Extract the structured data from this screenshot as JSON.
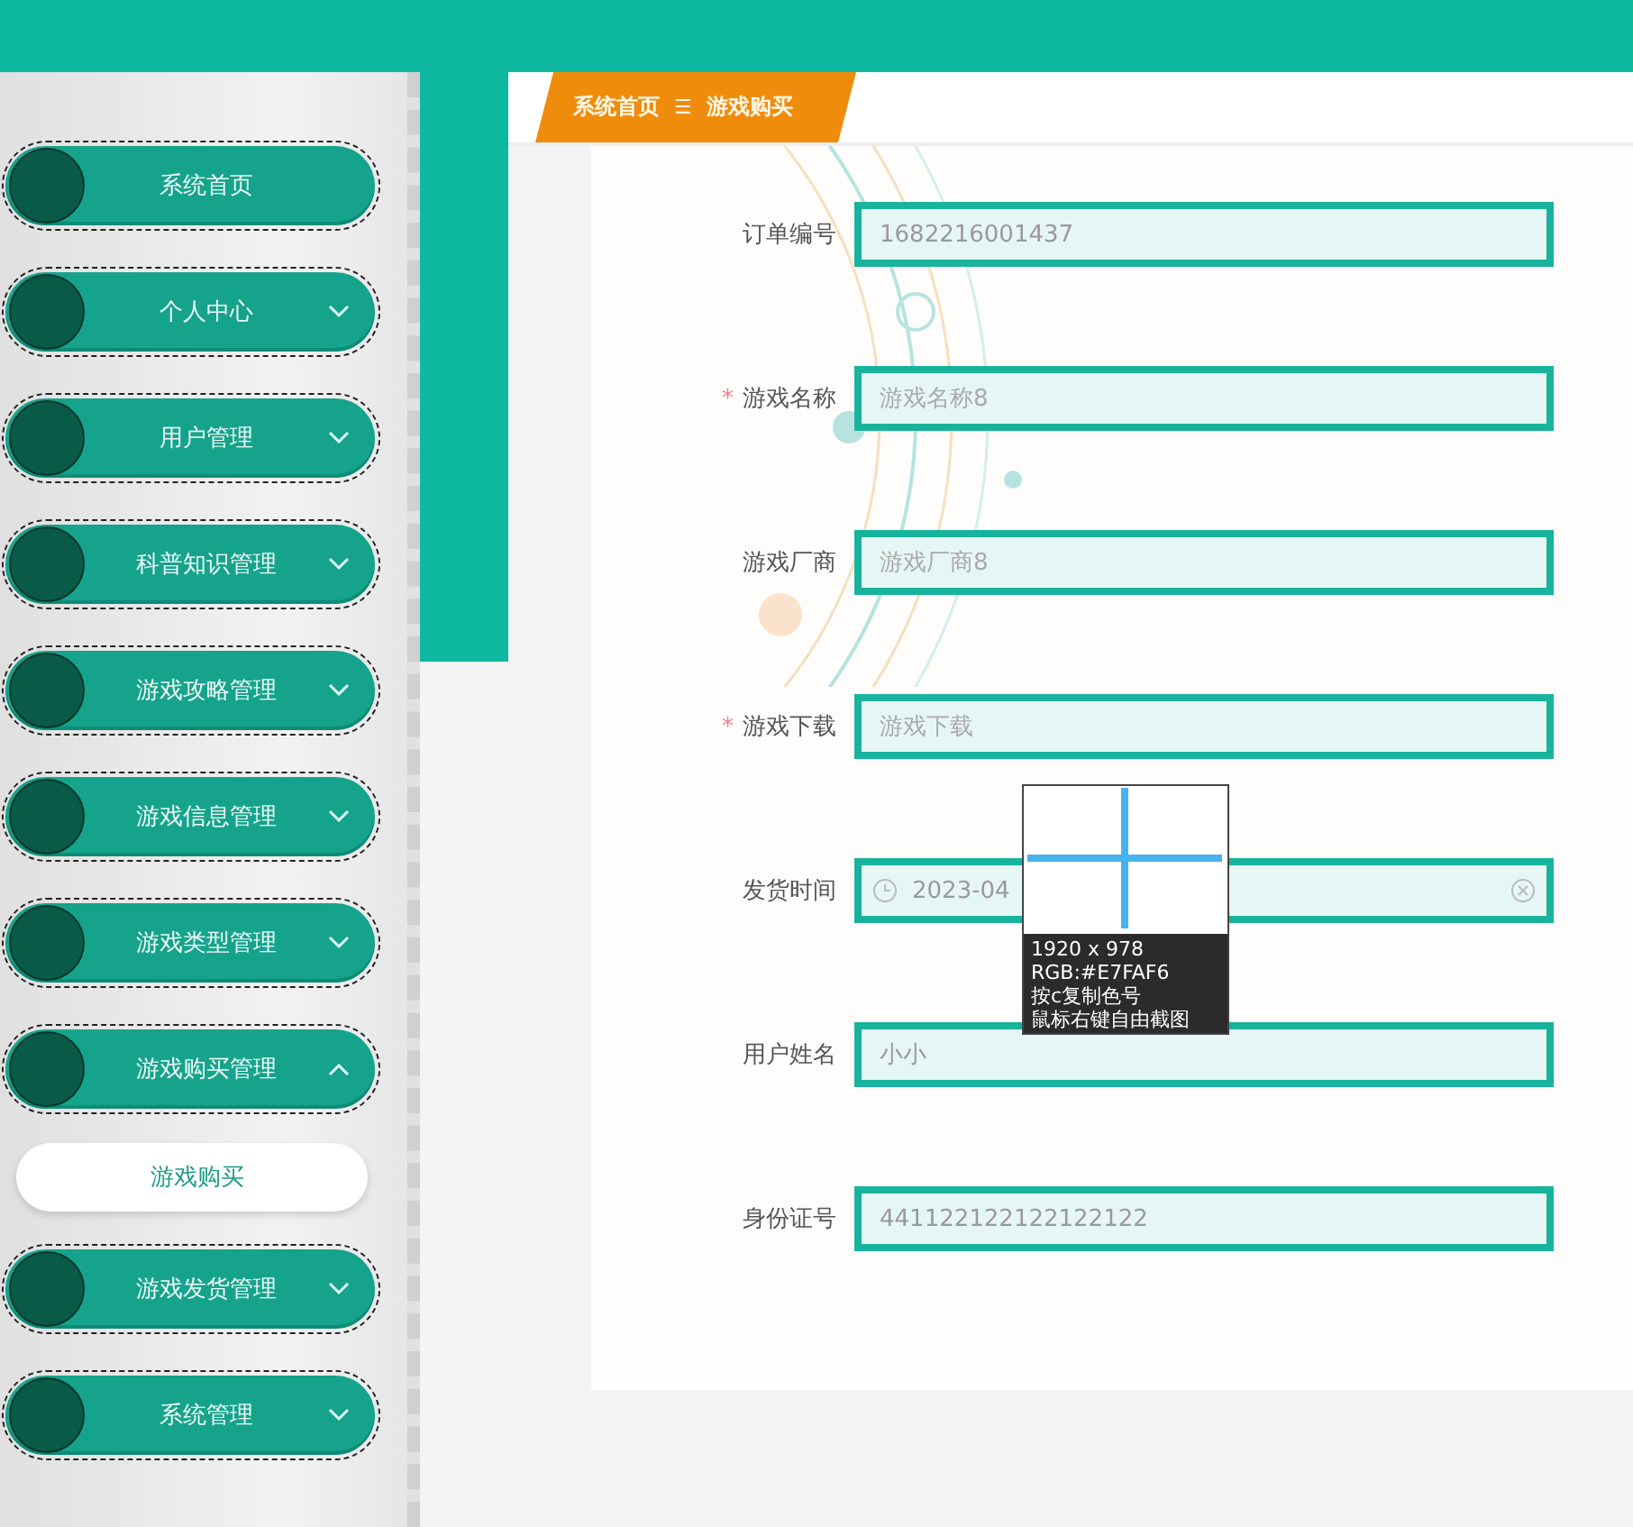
{
  "sidebar": {
    "items": [
      {
        "label": "系统首页",
        "expandable": false
      },
      {
        "label": "个人中心",
        "expandable": true,
        "expanded": false
      },
      {
        "label": "用户管理",
        "expandable": true,
        "expanded": false
      },
      {
        "label": "科普知识管理",
        "expandable": true,
        "expanded": false
      },
      {
        "label": "游戏攻略管理",
        "expandable": true,
        "expanded": false
      },
      {
        "label": "游戏信息管理",
        "expandable": true,
        "expanded": false
      },
      {
        "label": "游戏类型管理",
        "expandable": true,
        "expanded": false
      },
      {
        "label": "游戏购买管理",
        "expandable": true,
        "expanded": true,
        "children": [
          {
            "label": "游戏购买",
            "selected": true
          }
        ]
      },
      {
        "label": "游戏发货管理",
        "expandable": true,
        "expanded": false
      },
      {
        "label": "系统管理",
        "expandable": true,
        "expanded": false
      }
    ]
  },
  "breadcrumb": {
    "items": [
      "系统首页",
      "游戏购买"
    ],
    "separator": "☰"
  },
  "form": {
    "required_mark": "*",
    "fields": [
      {
        "label": "订单编号",
        "required": false,
        "kind": "text",
        "value": "1682216001437"
      },
      {
        "label": "游戏名称",
        "required": true,
        "kind": "text",
        "placeholder": "游戏名称8"
      },
      {
        "label": "游戏厂商",
        "required": false,
        "kind": "text",
        "placeholder": "游戏厂商8"
      },
      {
        "label": "游戏下载",
        "required": true,
        "kind": "text",
        "placeholder": "游戏下载"
      },
      {
        "label": "发货时间",
        "required": false,
        "kind": "date",
        "value": "2023-04"
      },
      {
        "label": "用户姓名",
        "required": false,
        "kind": "text",
        "value": "小小"
      },
      {
        "label": "身份证号",
        "required": false,
        "kind": "text",
        "value": "441122122122122122"
      }
    ]
  },
  "color_picker": {
    "size": "1920 x 978",
    "rgb_text": "RGB:#E7FAF6",
    "hint_1": "按c复制色号",
    "hint_2": "鼠标右键自由截图"
  }
}
